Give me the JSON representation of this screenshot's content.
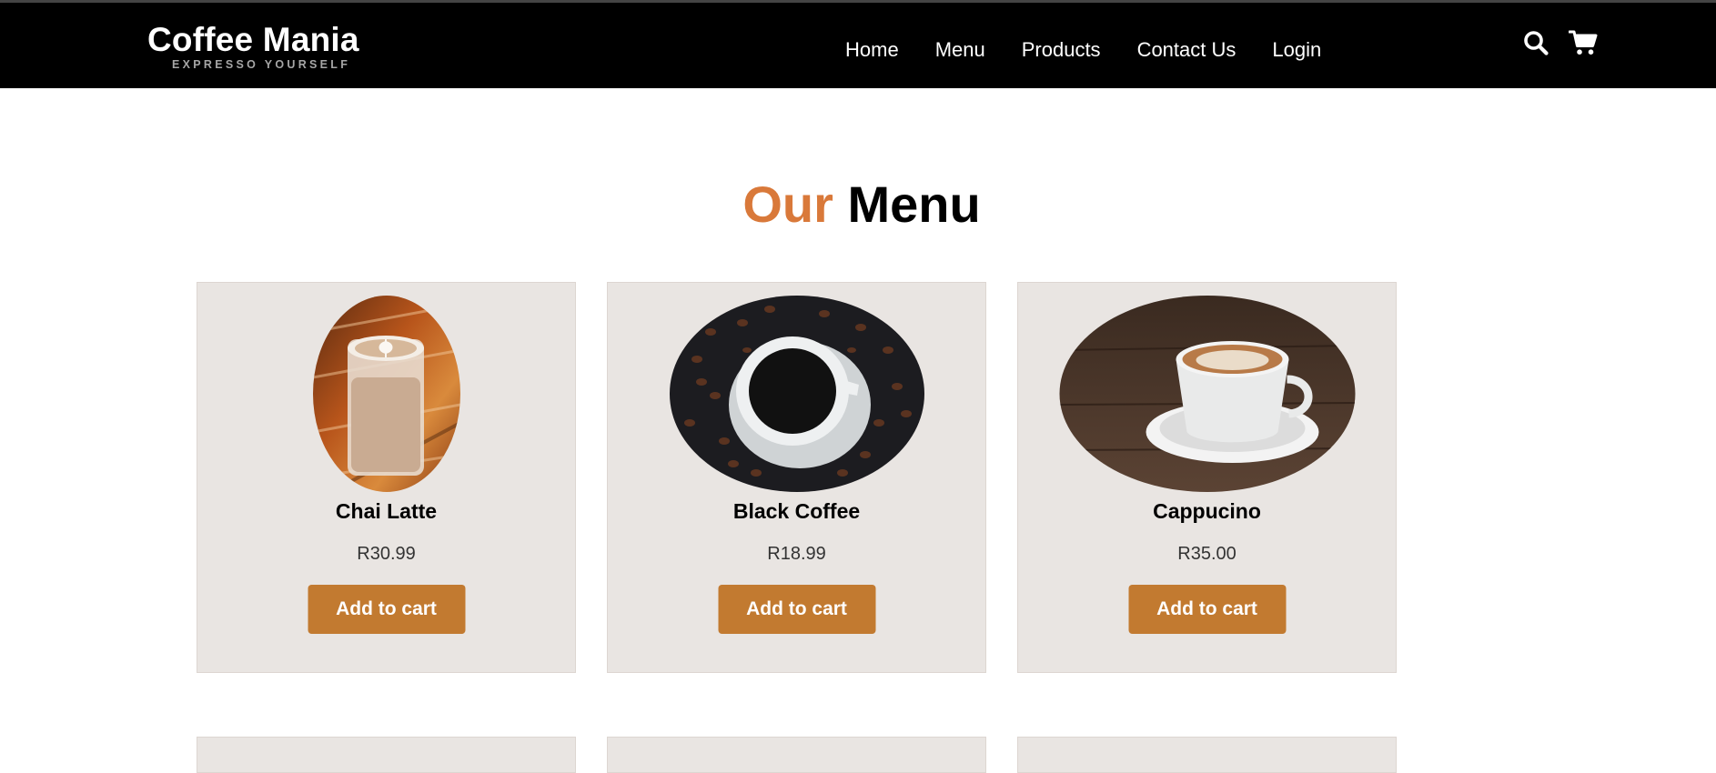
{
  "brand": {
    "title": "Coffee Mania",
    "tagline": "EXPRESSO YOURSELF"
  },
  "nav": {
    "links": [
      "Home",
      "Menu",
      "Products",
      "Contact Us",
      "Login"
    ],
    "icons": [
      "search-icon",
      "cart-icon"
    ]
  },
  "heading": {
    "accent": "Our",
    "rest": "Menu"
  },
  "colors": {
    "navbar": "#000000",
    "accent": "#d9793a",
    "button": "#c27a30",
    "card_bg": "#e9e5e2"
  },
  "menu": {
    "items": [
      {
        "name": "Chai Latte",
        "price": "R30.99",
        "button": "Add to cart"
      },
      {
        "name": "Black Coffee",
        "price": "R18.99",
        "button": "Add to cart"
      },
      {
        "name": "Cappucino",
        "price": "R35.00",
        "button": "Add to cart"
      }
    ]
  }
}
